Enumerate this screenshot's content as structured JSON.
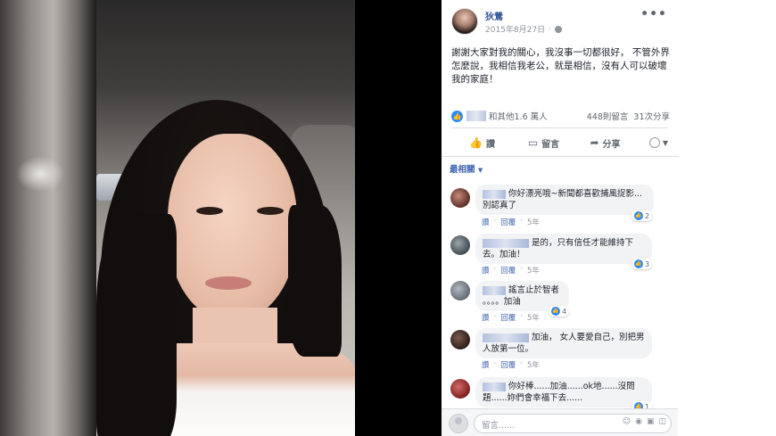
{
  "post": {
    "author": "狄鶯",
    "date": "2015年8月27日",
    "more": "•••",
    "text": "謝謝大家對我的關心，我沒事一切都很好， 不管外界怎麼說，我相信我老公，就是相信，沒有人可以破壞我的家庭！",
    "reactions_text": "和其他1.6 萬人",
    "comments_count": "448則留言",
    "shares_count": "31次分享"
  },
  "actions": {
    "like": "讚",
    "comment": "留言",
    "share": "分享"
  },
  "sort": {
    "label": "最相關"
  },
  "comments": [
    {
      "text": "你好漂亮哦~新聞都喜歡捕風捉影...別認真了",
      "like": "讚",
      "reply": "回覆",
      "age": "5年",
      "reactions": "2"
    },
    {
      "text": "是的，只有信任才能維持下去。加油！",
      "like": "讚",
      "reply": "回覆",
      "age": "5年",
      "reactions": "3"
    },
    {
      "text": "謠言止於智者 。。。。加油",
      "like": "讚",
      "reply": "回覆",
      "age": "5年",
      "reactions": "4"
    },
    {
      "text": "加油， 女人要愛自己，別把男人放第一位。",
      "like": "讚",
      "reply": "回覆",
      "age": "5年",
      "reactions": ""
    },
    {
      "text": "你好棒......加油......ok地......沒問題......妳們會幸福下去......",
      "like": "",
      "reply": "",
      "age": "",
      "reactions": "1"
    }
  ],
  "comment_box": {
    "placeholder": "留言......"
  },
  "icons": {
    "globe": "globe-icon",
    "like": "thumbs-up-icon",
    "comment": "speech-bubble-icon",
    "share": "share-arrow-icon"
  },
  "colors": {
    "link": "#365899",
    "accent": "#4267b2",
    "like_blue": "#2d88ff"
  }
}
